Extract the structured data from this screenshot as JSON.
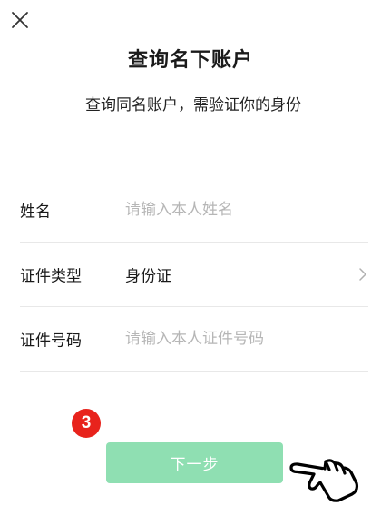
{
  "header": {
    "close_icon": "close-icon",
    "title": "查询名下账户",
    "subtitle": "查询同名账户，需验证你的身份"
  },
  "form": {
    "name": {
      "label": "姓名",
      "placeholder": "请输入本人姓名",
      "value": ""
    },
    "id_type": {
      "label": "证件类型",
      "value": "身份证",
      "icon": "chevron-right-icon"
    },
    "id_number": {
      "label": "证件号码",
      "placeholder": "请输入本人证件号码",
      "value": ""
    }
  },
  "annotation": {
    "step_number": "3",
    "color": "#e8231c",
    "pointer_icon": "hand-pointer-icon"
  },
  "actions": {
    "next_label": "下一步",
    "next_color": "#8fdfb2"
  }
}
